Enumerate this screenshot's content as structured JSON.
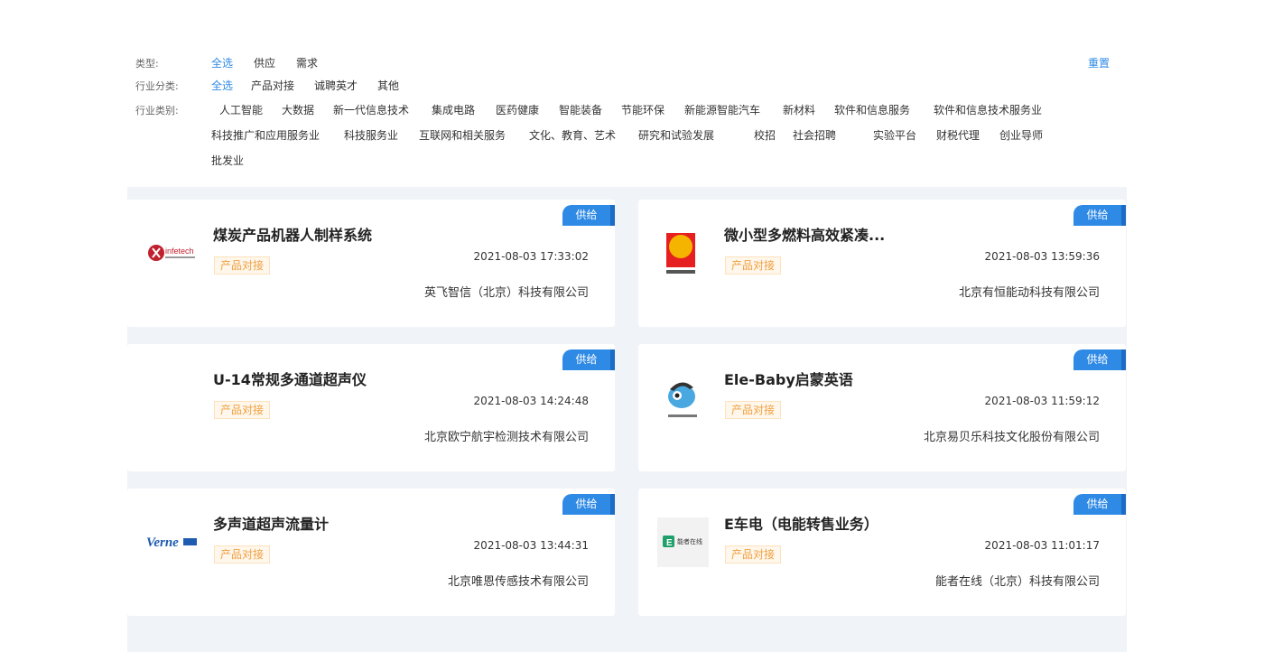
{
  "filters": {
    "type": {
      "label": "类型:",
      "options": [
        "全选",
        "供应",
        "需求"
      ]
    },
    "category": {
      "label": "行业分类:",
      "options": [
        "全选",
        "产品对接",
        "诚聘英才",
        "其他"
      ]
    },
    "industry": {
      "label": "行业类别:",
      "options": [
        "人工智能",
        "大数据",
        "新一代信息技术",
        "集成电路",
        "医药健康",
        "智能装备",
        "节能环保",
        "新能源智能汽车",
        "新材料",
        "软件和信息服务",
        "软件和信息技术服务业",
        "科技推广和应用服务业",
        "科技服务业",
        "互联网和相关服务",
        "文化、教育、艺术",
        "研究和试验发展",
        "校招",
        "社会招聘",
        "实验平台",
        "财税代理",
        "创业导师",
        "批发业"
      ]
    },
    "reset_label": "重置"
  },
  "cards": [
    {
      "badge": "供给",
      "title": "煤炭产品机器人制样系统",
      "tag": "产品对接",
      "date": "2021-08-03 17:33:02",
      "company": "英飞智信（北京）科技有限公司",
      "logo": "infetech-logo",
      "logo_text": "infetech"
    },
    {
      "badge": "供给",
      "title": "微小型多燃料高效紧凑...",
      "tag": "产品对接",
      "date": "2021-08-03 13:59:36",
      "company": "北京有恒能动科技有限公司",
      "logo": "youheng-logo"
    },
    {
      "badge": "供给",
      "title": "U-14常规多通道超声仪",
      "tag": "产品对接",
      "date": "2021-08-03 14:24:48",
      "company": "北京欧宁航宇检测技术有限公司",
      "logo": ""
    },
    {
      "badge": "供给",
      "title": "Ele-Baby启蒙英语",
      "tag": "产品对接",
      "date": "2021-08-03 11:59:12",
      "company": "北京易贝乐科技文化股份有限公司",
      "logo": "elebaby-logo"
    },
    {
      "badge": "供给",
      "title": "多声道超声流量计",
      "tag": "产品对接",
      "date": "2021-08-03 13:44:31",
      "company": "北京唯恩传感技术有限公司",
      "logo": "verne-logo",
      "logo_text": "Verne"
    },
    {
      "badge": "供给",
      "title": "E车电（电能转售业务）",
      "tag": "产品对接",
      "date": "2021-08-03 11:01:17",
      "company": "能者在线（北京）科技有限公司",
      "logo": "nengzhe-logo",
      "logo_text": "能者在线"
    }
  ],
  "colors": {
    "accent": "#2f8ae5",
    "tag": "#f0a040",
    "grid_bg": "#f0f3f7"
  }
}
